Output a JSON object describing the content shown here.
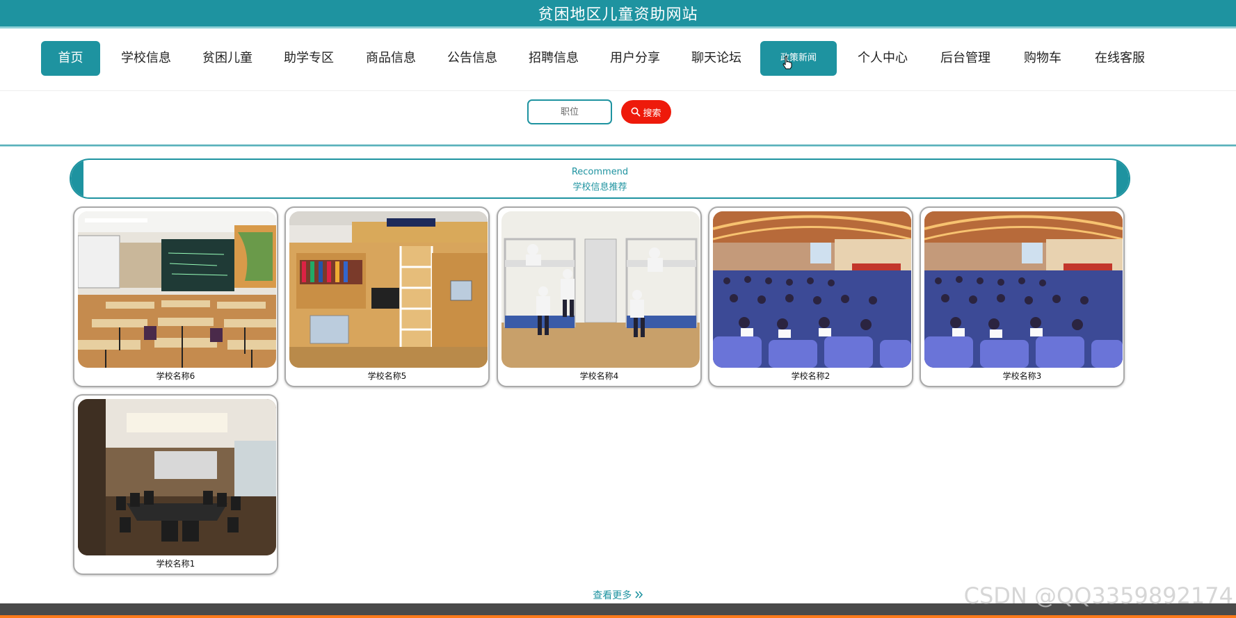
{
  "header": {
    "title": "贫困地区儿童资助网站"
  },
  "nav": {
    "items": [
      {
        "label": "首页"
      },
      {
        "label": "学校信息"
      },
      {
        "label": "贫困儿童"
      },
      {
        "label": "助学专区"
      },
      {
        "label": "商品信息"
      },
      {
        "label": "公告信息"
      },
      {
        "label": "招聘信息"
      },
      {
        "label": "用户分享"
      },
      {
        "label": "聊天论坛"
      },
      {
        "label": "政策新闻"
      },
      {
        "label": "个人中心"
      },
      {
        "label": "后台管理"
      },
      {
        "label": "购物车"
      },
      {
        "label": "在线客服"
      }
    ],
    "active_index": 0,
    "hovered_index": 9
  },
  "search": {
    "placeholder": "职位",
    "button_label": "搜索"
  },
  "recommend": {
    "en": "Recommend",
    "title": "学校信息推荐"
  },
  "schools": [
    {
      "name": "学校名称6",
      "image": "classroom"
    },
    {
      "name": "学校名称5",
      "image": "dorm-desk"
    },
    {
      "name": "学校名称4",
      "image": "dorm-bunks"
    },
    {
      "name": "学校名称2",
      "image": "auditorium"
    },
    {
      "name": "学校名称3",
      "image": "auditorium"
    },
    {
      "name": "学校名称1",
      "image": "meeting-room"
    }
  ],
  "more": {
    "label": "查看更多"
  },
  "watermark": "CSDN @QQ3359892174",
  "colors": {
    "accent": "#1e93a0",
    "search_button": "#ee1a0b"
  }
}
